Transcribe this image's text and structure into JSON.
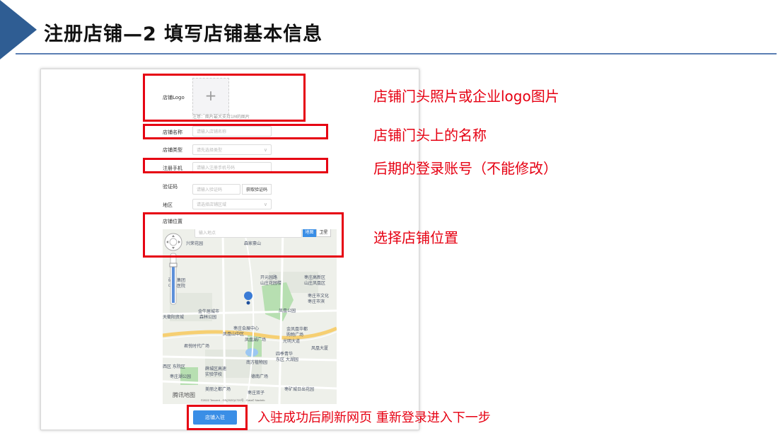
{
  "slide": {
    "title": "注册店铺—2  填写店铺基本信息"
  },
  "form": {
    "logo_label": "店铺Logo",
    "logo_hint": "注意：图片最大支持1M的图片",
    "name_label": "店铺名称",
    "name_placeholder": "请输入店铺名称",
    "type_label": "店铺类型",
    "type_placeholder": "请先选择类型",
    "phone_label": "注册手机",
    "phone_placeholder": "请输入注册手机号码",
    "code_label": "验证码",
    "code_placeholder": "请输入验证码",
    "code_button": "获取验证码",
    "region_label": "地区",
    "region_placeholder": "请选择店铺区域",
    "location_label": "店铺位置",
    "map_search_placeholder": "输入地点",
    "map_type_map": "地图",
    "map_type_satellite": "卫星",
    "submit_label": "店铺入驻"
  },
  "map": {
    "labels": [
      "兴荣花园",
      "森家豪山",
      "开元园路",
      "山庄花园楼",
      "枣庄高新区",
      "山庄凤凰区",
      "枣庄市文化",
      "枣庄市滨",
      "矿业集团",
      "中心医院",
      "金牛居城市",
      "森林公园",
      "凤凰公园",
      "天衢阳资城",
      "枣庄会展中心",
      "凤凰山中区",
      "金凤凰华都",
      "购物广场",
      "凤凰湖广场",
      "光明大道",
      "四季青华",
      "东区 大湖园",
      "风凰大厦",
      "南方植物园",
      "君悦时代广场",
      "西区 东院区",
      "薛城区高速",
      "实验学校",
      "枣庄湖公园",
      "德南广场",
      "美丽之都广场",
      "枣庄双子",
      "枣矿城日出花园"
    ],
    "brand": "腾讯地图",
    "copyright": "©2022 Tencent - GS(2020)1720号 - Data© NavInfo"
  },
  "annotations": {
    "logo": "店铺门头照片或企业logo图片",
    "name": "店铺门头上的名称",
    "phone": "后期的登录账号（不能修改）",
    "location": "选择店铺位置",
    "submit": "入驻成功后刷新网页 重新登录进入下一步"
  },
  "colors": {
    "accent": "#e60012",
    "brand": "#2f5d93",
    "button": "#3a8ee6"
  }
}
